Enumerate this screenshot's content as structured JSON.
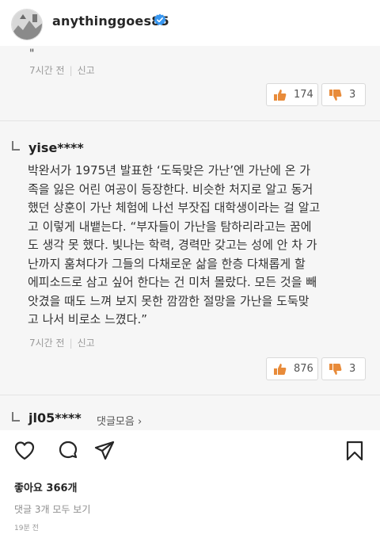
{
  "header": {
    "username": "anythinggoes85",
    "verified_icon": "verified-badge-icon"
  },
  "post": {
    "quote_tail": "\"",
    "comment1": {
      "time": "7시간 전",
      "report": "신고",
      "likes": "174",
      "dislikes": "3"
    },
    "comment2": {
      "author": "yise****",
      "text": "박완서가 1975년 발표한 ‘도둑맞은 가난’엔 가난에 온 가\n족을 잃은 어린 여공이 등장한다. 비슷한 처지로 알고 동거\n했던 상훈이 가난 체험에 나선 부잣집 대학생이라는 걸 알고\n고 이렇게 내뱉는다. “부자들이 가난을 탐하리라고는 꿈에\n도 생각 못 했다. 빛나는 학력, 경력만 갖고는 성에 안 차 가\n난까지 훔쳐다가 그들의 다채로운 삶을 한층 다채롭게 할\n에피소드로 삼고 싶어 한다는 건 미처 몰랐다. 모든 것을 빼\n앗겼을 때도 느껴 보지 못한 깜깜한 절망을 가난을 도둑맞\n고 나서 비로소 느꼈다.”",
      "time": "7시간 전",
      "report": "신고",
      "likes": "876",
      "dislikes": "3"
    },
    "comment3": {
      "author": "jl05****",
      "more": "댓글모음 ›"
    }
  },
  "footer": {
    "likes_text": "좋아요 366개",
    "view_comments": "댓글 3개 모두 보기",
    "time_ago": "19분 전"
  }
}
